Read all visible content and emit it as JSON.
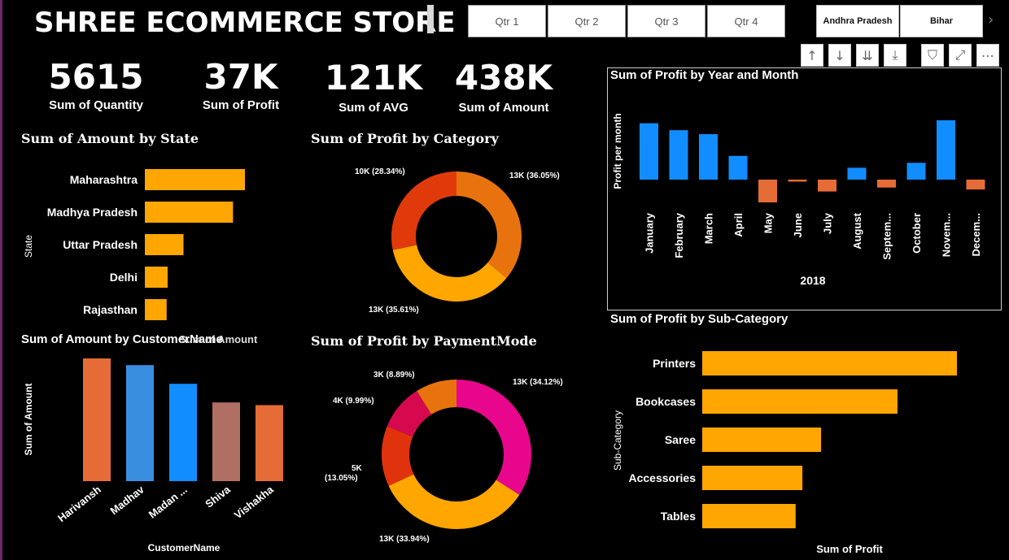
{
  "header": {
    "title": "SHREE ECOMMERCE STORE",
    "quarters": [
      "Qtr 1",
      "Qtr 2",
      "Qtr 3",
      "Qtr 4"
    ],
    "states": [
      "Andhra Pradesh",
      "Bihar"
    ]
  },
  "toolbar_icons": [
    "arrow-up-icon",
    "arrow-down-icon",
    "double-arrow-down-icon",
    "expand-hierarchy-icon",
    "filter-icon",
    "focus-mode-icon",
    "more-options-icon"
  ],
  "kpis": [
    {
      "value": "5615",
      "label": "Sum of Quantity"
    },
    {
      "value": "37K",
      "label": "Sum of Profit"
    },
    {
      "value": "121K",
      "label": "Sum of AVG"
    },
    {
      "value": "438K",
      "label": "Sum of Amount"
    }
  ],
  "colors": {
    "orange_bar": "#FFA600",
    "blue": "#118DFF",
    "negative": "#E66C37",
    "cat_a": "#E8730E",
    "cat_b": "#FFA600",
    "cat_c": "#E03A0B",
    "pay_pink": "#E8078C",
    "pay_orange": "#FFA600",
    "pay_red": "#E0330D",
    "pay_crimson": "#D6094E",
    "pay_amber": "#E8730E"
  },
  "chart_data": [
    {
      "type": "bar",
      "orientation": "horizontal",
      "title": "Sum of Amount by State",
      "ylabel": "State",
      "categories": [
        "Maharashtra",
        "Madhya Pradesh",
        "Uttar Pradesh",
        "Delhi",
        "Rajasthan"
      ],
      "values": [
        101000,
        89000,
        39000,
        23000,
        22000
      ]
    },
    {
      "type": "pie",
      "donut": true,
      "title": "Sum of Profit by Category",
      "slices": [
        {
          "label": "13K (36.05%)",
          "value": 36.05
        },
        {
          "label": "13K (35.61%)",
          "value": 35.61
        },
        {
          "label": "10K (28.34%)",
          "value": 28.34
        }
      ]
    },
    {
      "type": "bar",
      "title": "Sum of Profit by Year and Month",
      "xlabel": "2018",
      "ylabel": "Profit per month",
      "categories": [
        "January",
        "February",
        "March",
        "April",
        "May",
        "June",
        "July",
        "August",
        "Septem...",
        "October",
        "Novem...",
        "Decem..."
      ],
      "values": [
        5700,
        5000,
        4600,
        2400,
        -2300,
        -200,
        -1200,
        1200,
        -800,
        1700,
        6000,
        -1000
      ]
    },
    {
      "type": "bar",
      "title": "Sum of Amount by CustomerName",
      "overlap_label": "Sum of Amount",
      "xlabel": "CustomerName",
      "ylabel": "Sum of Amount",
      "categories": [
        "Harivansh",
        "Madhav",
        "Madan ...",
        "Shiva",
        "Vishakha"
      ],
      "values": [
        9200,
        8700,
        7300,
        5900,
        5700
      ]
    },
    {
      "type": "pie",
      "donut": true,
      "title": "Sum of Profit by PaymentMode",
      "slices": [
        {
          "label": "13K (34.12%)",
          "value": 34.12
        },
        {
          "label": "13K (33.94%)",
          "value": 33.94
        },
        {
          "label": "5K\n(13.05%)",
          "value": 13.05
        },
        {
          "label": "4K (9.99%)",
          "value": 9.99
        },
        {
          "label": "3K (8.89%)",
          "value": 8.89
        }
      ]
    },
    {
      "type": "bar",
      "orientation": "horizontal",
      "title": "Sum of Profit by Sub-Category",
      "xlabel": "Sum of Profit",
      "ylabel": "Sub-Category",
      "categories": [
        "Printers",
        "Bookcases",
        "Saree",
        "Accessories",
        "Tables"
      ],
      "values": [
        15000,
        11500,
        7000,
        5900,
        5500
      ]
    }
  ]
}
